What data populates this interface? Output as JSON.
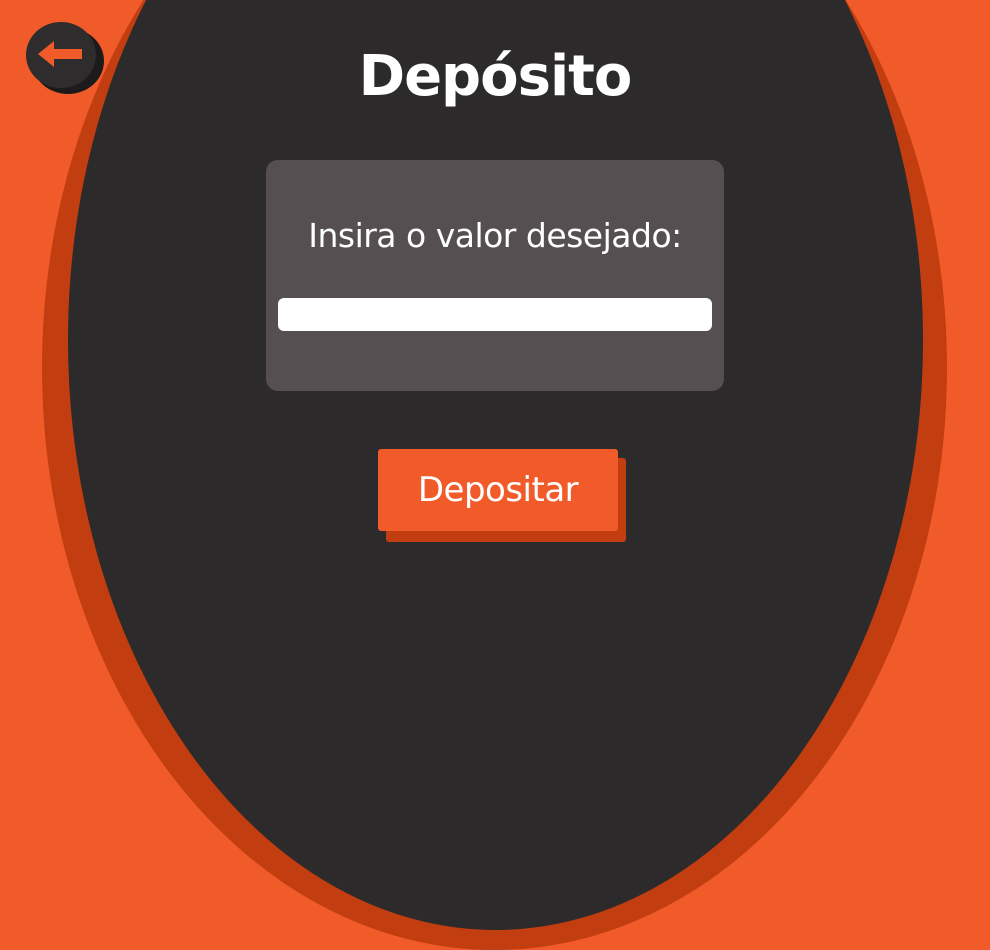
{
  "page": {
    "title": "Depósito"
  },
  "back_button": {
    "icon": "arrow-left-icon"
  },
  "form": {
    "label": "Insira o valor desejado:",
    "value": "",
    "placeholder": ""
  },
  "actions": {
    "deposit_label": "Depositar"
  },
  "colors": {
    "background": "#f15a29",
    "circle": "#2c2a2b",
    "circle_shadow": "#c23d10",
    "panel": "#564f52",
    "accent": "#f15a29",
    "text": "#ffffff"
  }
}
